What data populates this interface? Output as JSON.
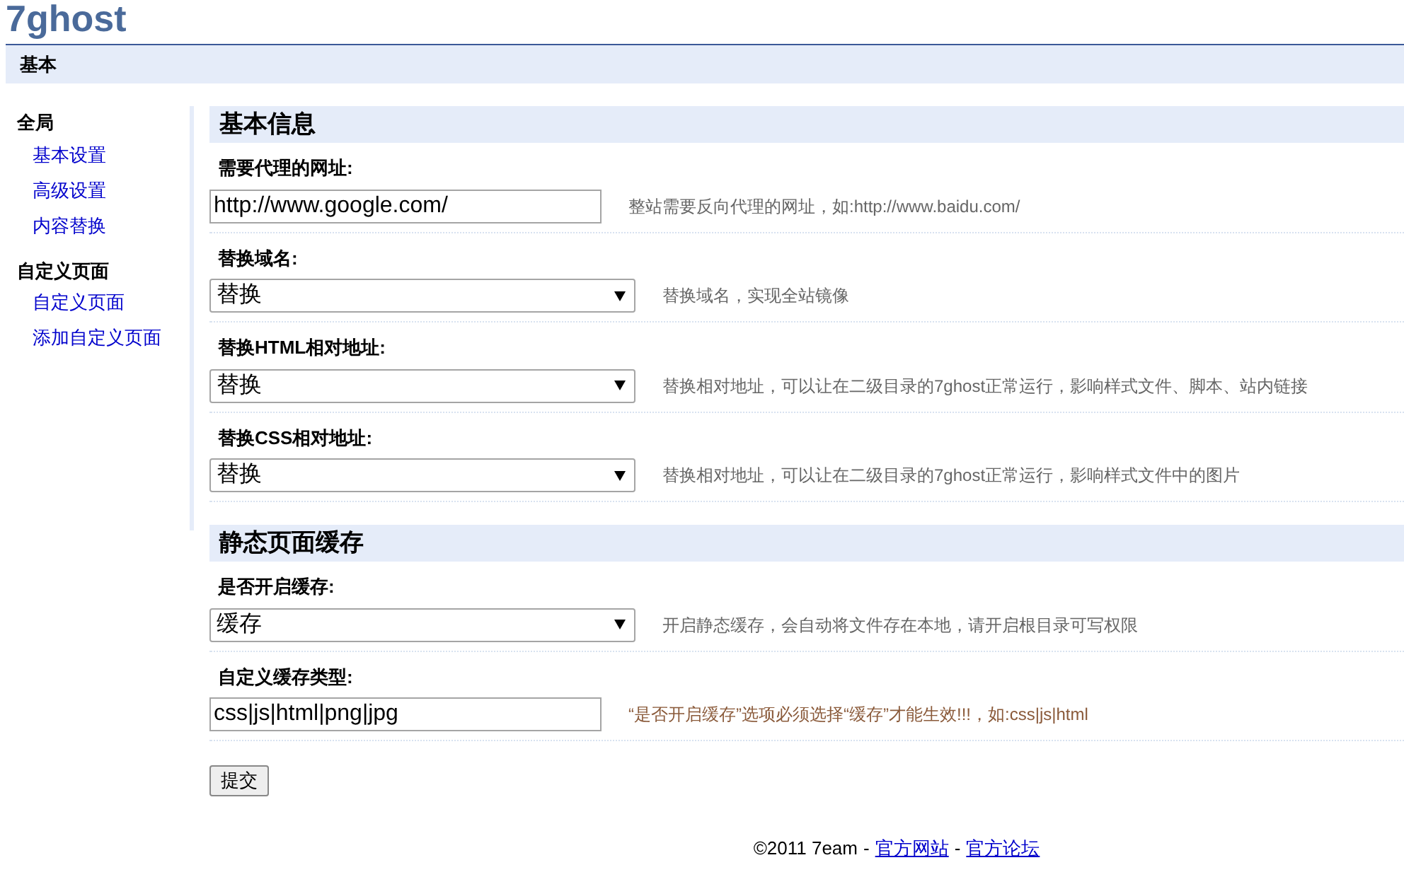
{
  "logo": "7ghost",
  "nav": {
    "title": "基本"
  },
  "sidebar": [
    {
      "title": "全局",
      "items": [
        "基本设置",
        "高级设置",
        "内容替换"
      ]
    },
    {
      "title": "自定义页面",
      "items": [
        "自定义页面",
        "添加自定义页面"
      ]
    }
  ],
  "sections": [
    {
      "title": "基本信息",
      "rows": [
        {
          "label": "需要代理的网址:",
          "kind": "text",
          "value": "http://www.google.com/",
          "hint": "整站需要反向代理的网址，如:http://www.baidu.com/",
          "warning": false
        },
        {
          "label": "替换域名:",
          "kind": "select",
          "value": "替换",
          "hint": "替换域名，实现全站镜像",
          "warning": false
        },
        {
          "label": "替换HTML相对地址:",
          "kind": "select",
          "value": "替换",
          "hint": "替换相对地址，可以让在二级目录的7ghost正常运行，影响样式文件、脚本、站内链接",
          "warning": false
        },
        {
          "label": "替换CSS相对地址:",
          "kind": "select",
          "value": "替换",
          "hint": "替换相对地址，可以让在二级目录的7ghost正常运行，影响样式文件中的图片",
          "warning": false
        }
      ]
    },
    {
      "title": "静态页面缓存",
      "rows": [
        {
          "label": "是否开启缓存:",
          "kind": "select",
          "value": "缓存",
          "hint": "开启静态缓存，会自动将文件存在本地，请开启根目录可写权限",
          "warning": false
        },
        {
          "label": "自定义缓存类型:",
          "kind": "text",
          "value": "css|js|html|png|jpg",
          "hint": "“是否开启缓存”选项必须选择“缓存”才能生效!!!，如:css|js|html",
          "warning": true
        }
      ]
    }
  ],
  "submit": "提交",
  "footer": {
    "copyright": "©2011 7eam",
    "separator_1": "-",
    "link_1": "官方网站",
    "separator_2": "-",
    "link_2": "官方论坛"
  }
}
